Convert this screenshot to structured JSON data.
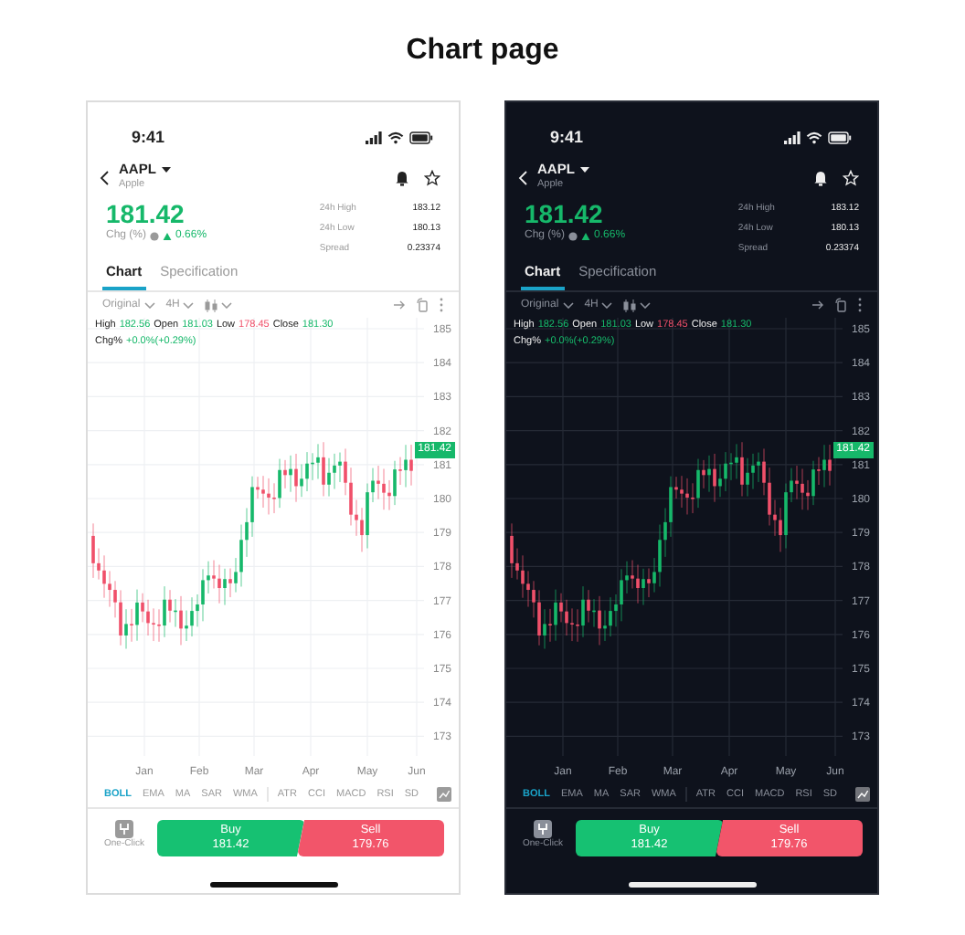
{
  "title": "Chart page",
  "phones": [
    {
      "kind": "light",
      "time": "9:41",
      "symbol": "AAPL",
      "company": "Apple",
      "price": "181.42",
      "change_label": "Chg (%)",
      "change": "0.66%",
      "stats": [
        {
          "label": "24h High",
          "value": "183.12"
        },
        {
          "label": "24h Low",
          "value": "180.13"
        },
        {
          "label": "Spread",
          "value": "0.23374"
        }
      ],
      "tabs": [
        {
          "label": "Chart",
          "selected": true
        },
        {
          "label": "Specification",
          "selected": false
        }
      ],
      "toolbar": {
        "chart_type": "Original",
        "interval": "4H"
      },
      "legend": [
        {
          "label": "High",
          "value": "182.56",
          "color": "#16b86a"
        },
        {
          "label": "Open",
          "value": "181.03",
          "color": "#16b86a"
        },
        {
          "label": "Low",
          "value": "178.45",
          "color": "#f0506a"
        },
        {
          "label": "Close",
          "value": "181.30",
          "color": "#16b86a"
        }
      ],
      "change_line": {
        "label": "Chg%",
        "value": "+0.0%(+0.29%)"
      },
      "y_ticks": [
        "185",
        "184",
        "183",
        "182",
        "181",
        "180",
        "179",
        "178",
        "177",
        "176",
        "175",
        "174",
        "173"
      ],
      "x_labels": [
        "Jan",
        "Feb",
        "Mar",
        "Apr",
        "May",
        "Jun"
      ],
      "last_price": "181.42",
      "indicators": [
        [
          {
            "label": "BOLL",
            "selected": true
          },
          {
            "label": "EMA",
            "selected": false
          },
          {
            "label": "MA",
            "selected": false
          },
          {
            "label": "SAR",
            "selected": false
          },
          {
            "label": "WMA",
            "selected": false
          }
        ],
        [
          {
            "label": "ATR",
            "selected": false
          },
          {
            "label": "CCI",
            "selected": false
          },
          {
            "label": "MACD",
            "selected": false
          },
          {
            "label": "RSI",
            "selected": false
          },
          {
            "label": "SD",
            "selected": false
          }
        ]
      ],
      "one_click": "One-Click",
      "buy": {
        "label": "Buy",
        "price": "181.42"
      },
      "sell": {
        "label": "Sell",
        "price": "179.76"
      }
    },
    {
      "kind": "dark",
      "time": "9:41",
      "symbol": "AAPL",
      "company": "Apple",
      "price": "181.42",
      "change_label": "Chg (%)",
      "change": "0.66%",
      "stats": [
        {
          "label": "24h High",
          "value": "183.12"
        },
        {
          "label": "24h Low",
          "value": "180.13"
        },
        {
          "label": "Spread",
          "value": "0.23374"
        }
      ],
      "tabs": [
        {
          "label": "Chart",
          "selected": true
        },
        {
          "label": "Specification",
          "selected": false
        }
      ],
      "toolbar": {
        "chart_type": "Original",
        "interval": "4H"
      },
      "legend": [
        {
          "label": "High",
          "value": "182.56",
          "color": "#16b86a"
        },
        {
          "label": "Open",
          "value": "181.03",
          "color": "#16b86a"
        },
        {
          "label": "Low",
          "value": "178.45",
          "color": "#f0506a"
        },
        {
          "label": "Close",
          "value": "181.30",
          "color": "#16b86a"
        }
      ],
      "change_line": {
        "label": "Chg%",
        "value": "+0.0%(+0.29%)"
      },
      "y_ticks": [
        "185",
        "184",
        "183",
        "182",
        "181",
        "180",
        "179",
        "178",
        "177",
        "176",
        "175",
        "174",
        "173"
      ],
      "x_labels": [
        "Jan",
        "Feb",
        "Mar",
        "Apr",
        "May",
        "Jun"
      ],
      "last_price": "181.42",
      "indicators": [
        [
          {
            "label": "BOLL",
            "selected": true
          },
          {
            "label": "EMA",
            "selected": false
          },
          {
            "label": "MA",
            "selected": false
          },
          {
            "label": "SAR",
            "selected": false
          },
          {
            "label": "WMA",
            "selected": false
          }
        ],
        [
          {
            "label": "ATR",
            "selected": false
          },
          {
            "label": "CCI",
            "selected": false
          },
          {
            "label": "MACD",
            "selected": false
          },
          {
            "label": "RSI",
            "selected": false
          },
          {
            "label": "SD",
            "selected": false
          }
        ]
      ],
      "one_click": "One-Click",
      "buy": {
        "label": "Buy",
        "price": "181.42"
      },
      "sell": {
        "label": "Sell",
        "price": "179.76"
      }
    }
  ]
}
